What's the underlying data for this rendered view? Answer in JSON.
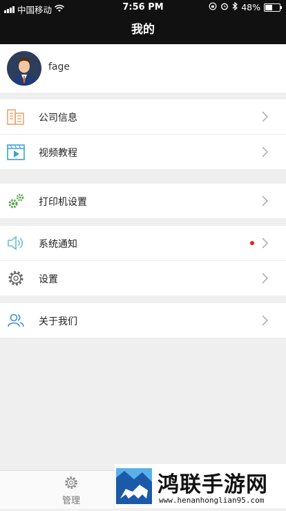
{
  "status_bar": {
    "carrier": "中国移动",
    "time": "7:56 PM",
    "battery": "48%",
    "battery_level": 0.48
  },
  "header": {
    "title": "我的"
  },
  "profile": {
    "name": "fage"
  },
  "menu_groups": [
    [
      {
        "label": "公司信息",
        "icon": "building-icon"
      },
      {
        "label": "视频教程",
        "icon": "video-tutorial-icon"
      }
    ],
    [
      {
        "label": "打印机设置",
        "icon": "gears-icon"
      }
    ],
    [
      {
        "label": "系统通知",
        "icon": "speaker-icon",
        "badge": "red-dot"
      },
      {
        "label": "设置",
        "icon": "gear-icon"
      }
    ],
    [
      {
        "label": "关于我们",
        "icon": "users-icon"
      }
    ]
  ],
  "tab_bar": {
    "manage_label": "管理"
  },
  "watermark": {
    "title": "鸿联手游网",
    "url": "www.henanhonglian95.com"
  },
  "colors": {
    "header_bg": "#111111",
    "notification_dot": "#e0221b",
    "page_bg": "#efeff0"
  }
}
